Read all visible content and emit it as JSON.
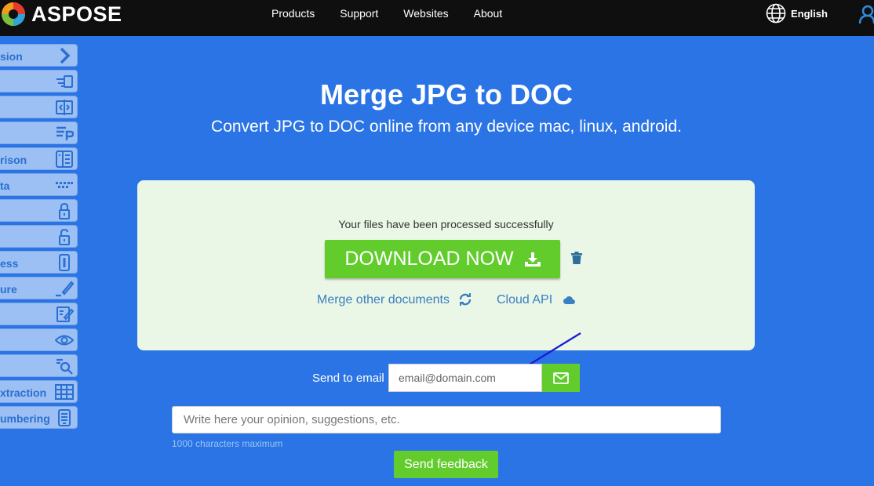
{
  "header": {
    "logo_text": "ASPOSE",
    "nav": [
      "Products",
      "Support",
      "Websites",
      "About"
    ],
    "language": "English"
  },
  "sidebar": {
    "items": [
      {
        "label": "sion",
        "icon": "chevron-right-icon"
      },
      {
        "label": "",
        "icon": "merge-icon"
      },
      {
        "label": "",
        "icon": "split-icon"
      },
      {
        "label": "",
        "icon": "text-parser-icon"
      },
      {
        "label": "rison",
        "icon": "compare-icon"
      },
      {
        "label": "ta",
        "icon": "metadata-icon"
      },
      {
        "label": "",
        "icon": "lock-icon"
      },
      {
        "label": "",
        "icon": "unlock-icon"
      },
      {
        "label": "ess",
        "icon": "compress-icon"
      },
      {
        "label": "ure",
        "icon": "signature-icon"
      },
      {
        "label": "",
        "icon": "editor-icon"
      },
      {
        "label": "",
        "icon": "eye-icon"
      },
      {
        "label": "",
        "icon": "search-icon"
      },
      {
        "label": "xtraction",
        "icon": "table-icon"
      },
      {
        "label": "umbering",
        "icon": "numbering-icon"
      }
    ]
  },
  "main": {
    "title": "Merge JPG to DOC",
    "subtitle": "Convert JPG to DOC online from any device mac, linux, android.",
    "success_message": "Your files have been processed successfully",
    "download_label": "DOWNLOAD NOW",
    "merge_other_label": "Merge other documents",
    "cloud_api_label": "Cloud API"
  },
  "email": {
    "label": "Send to email",
    "placeholder": "email@domain.com"
  },
  "feedback": {
    "placeholder": "Write here your opinion, suggestions, etc.",
    "hint": "1000 characters maximum",
    "button_label": "Send feedback"
  },
  "colors": {
    "background": "#2a74e6",
    "header": "#0f0f0f",
    "accent_green": "#62cc2d",
    "panel": "#eaf6e6",
    "link": "#3a7fc2"
  }
}
